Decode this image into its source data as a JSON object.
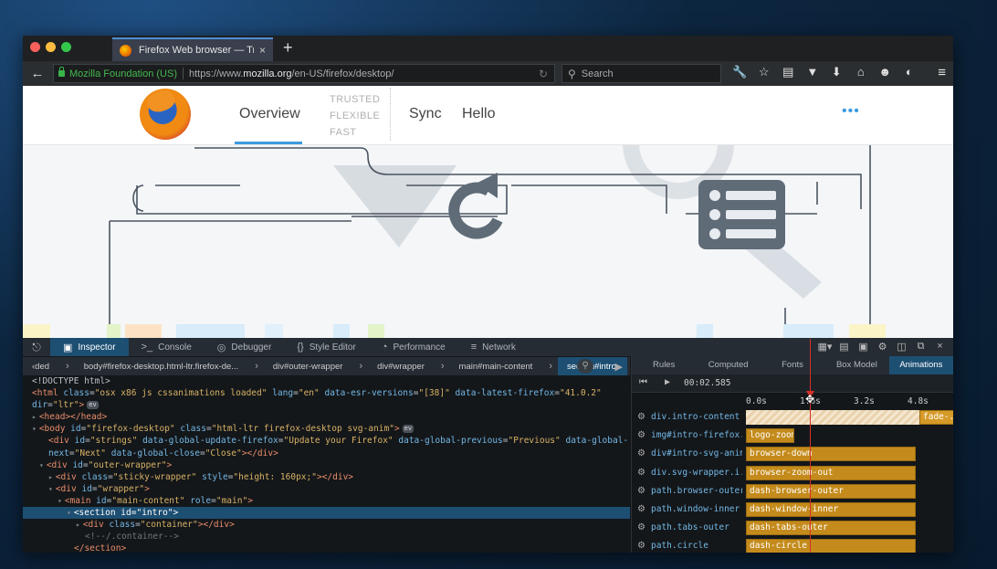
{
  "browser": {
    "tab_title": "Firefox Web browser — Trust...",
    "tab_close": "×",
    "new_tab": "+",
    "back": "←",
    "site_identity": "Mozilla Foundation (US)",
    "url_prefix": "https://www.",
    "url_host": "mozilla.org",
    "url_path": "/en-US/firefox/desktop/",
    "reload": "↻",
    "search_placeholder": "Search",
    "toolbar_icons": [
      "wrench-icon",
      "bookmark-star-icon",
      "reading-list-icon",
      "pocket-icon",
      "download-icon",
      "home-icon",
      "hello-icon",
      "sync-icon"
    ],
    "menu": "≡"
  },
  "page": {
    "nav_overview": "Overview",
    "taglines": [
      "TRUSTED",
      "FLEXIBLE",
      "FAST"
    ],
    "nav_sync": "Sync",
    "nav_hello": "Hello",
    "nav_more": "•••"
  },
  "devtools": {
    "tabs": [
      {
        "icon": "▣",
        "label": "Inspector"
      },
      {
        "icon": ">_",
        "label": "Console"
      },
      {
        "icon": "◎",
        "label": "Debugger"
      },
      {
        "icon": "{}",
        "label": "Style Editor"
      },
      {
        "icon": "◔",
        "label": "Performance"
      },
      {
        "icon": "≡",
        "label": "Network"
      }
    ],
    "breadcrumbs": [
      "‹ded",
      "body#firefox-desktop.html-ltr.firefox-de...",
      "div#outer-wrapper",
      "div#wrapper",
      "main#main-content",
      "section#intro"
    ],
    "sidebar_tabs": [
      "Rules",
      "Computed",
      "Fonts",
      "Box Model",
      "Animations"
    ],
    "current_time": "00:02.585",
    "timeline_ticks": [
      "0.0s",
      "1.6s",
      "3.2s",
      "4.8s"
    ],
    "animations": [
      {
        "target": "div.intro-content",
        "name": "fade-..."
      },
      {
        "target": "img#intro-firefox...",
        "name": "logo-zoom"
      },
      {
        "target": "div#intro-svg-anim",
        "name": "browser-down"
      },
      {
        "target": "div.svg-wrapper.i...",
        "name": "browser-zoom-out"
      },
      {
        "target": "path.browser-outer",
        "name": "dash-browser-outer"
      },
      {
        "target": "path.window-inner",
        "name": "dash-window-inner"
      },
      {
        "target": "path.tabs-outer",
        "name": "dash-tabs-outer"
      },
      {
        "target": "path.circle",
        "name": "dash-circle"
      }
    ],
    "markup": {
      "doctype": "<!DOCTYPE html>",
      "html_class": "osx x86 js cssanimations loaded",
      "html_lang": "en",
      "html_esr": "[38]",
      "html_latest": "41.0.2",
      "html_dir": "ltr",
      "head": "<head></head>",
      "body_id": "firefox-desktop",
      "body_class": "html-ltr firefox-desktop svg-anim",
      "strings_id": "strings",
      "strings_update": "Update your Firefox",
      "strings_previous": "Previous",
      "strings_next": "Next",
      "strings_close": "Close",
      "outer_id": "outer-wrapper",
      "sticky_class": "sticky-wrapper",
      "sticky_style": "height: 160px;",
      "wrapper_id": "wrapper",
      "main_id": "main-content",
      "main_role": "main",
      "section_id": "intro",
      "container_class": "container",
      "comment": "<!--/.container-->",
      "section_close": "</section>",
      "ev": "ev"
    }
  },
  "colors": {
    "accent": "#1d4f73",
    "animation_bar": "#c48b1c",
    "playhead": "#d63028",
    "firefox_link": "#3d9ae0"
  }
}
